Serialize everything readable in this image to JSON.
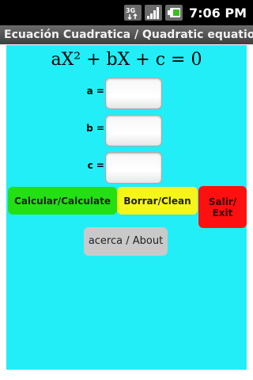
{
  "status_bar": {
    "time": "7:06 PM",
    "icons": [
      "network-3g-icon",
      "signal-strength-icon",
      "battery-icon"
    ],
    "network_label": "3G"
  },
  "title_bar": {
    "title": "Ecuación Cuadratica / Quadratic equation"
  },
  "equation": {
    "formula": "aX² + bX + c = 0"
  },
  "coefficients": [
    {
      "label": "a =",
      "value": ""
    },
    {
      "label": "b =",
      "value": ""
    },
    {
      "label": "c =",
      "value": ""
    }
  ],
  "buttons": {
    "calculate": "Calcular/Calculate",
    "clean": "Borrar/Clean",
    "exit_line1": "Salir/",
    "exit_line2": "Exit",
    "about": "acerca / About"
  },
  "colors": {
    "background": "#22eef7",
    "calculate": "#22e014",
    "clean": "#f5f51a",
    "exit": "#ff1010",
    "about": "#c9c9c9"
  }
}
